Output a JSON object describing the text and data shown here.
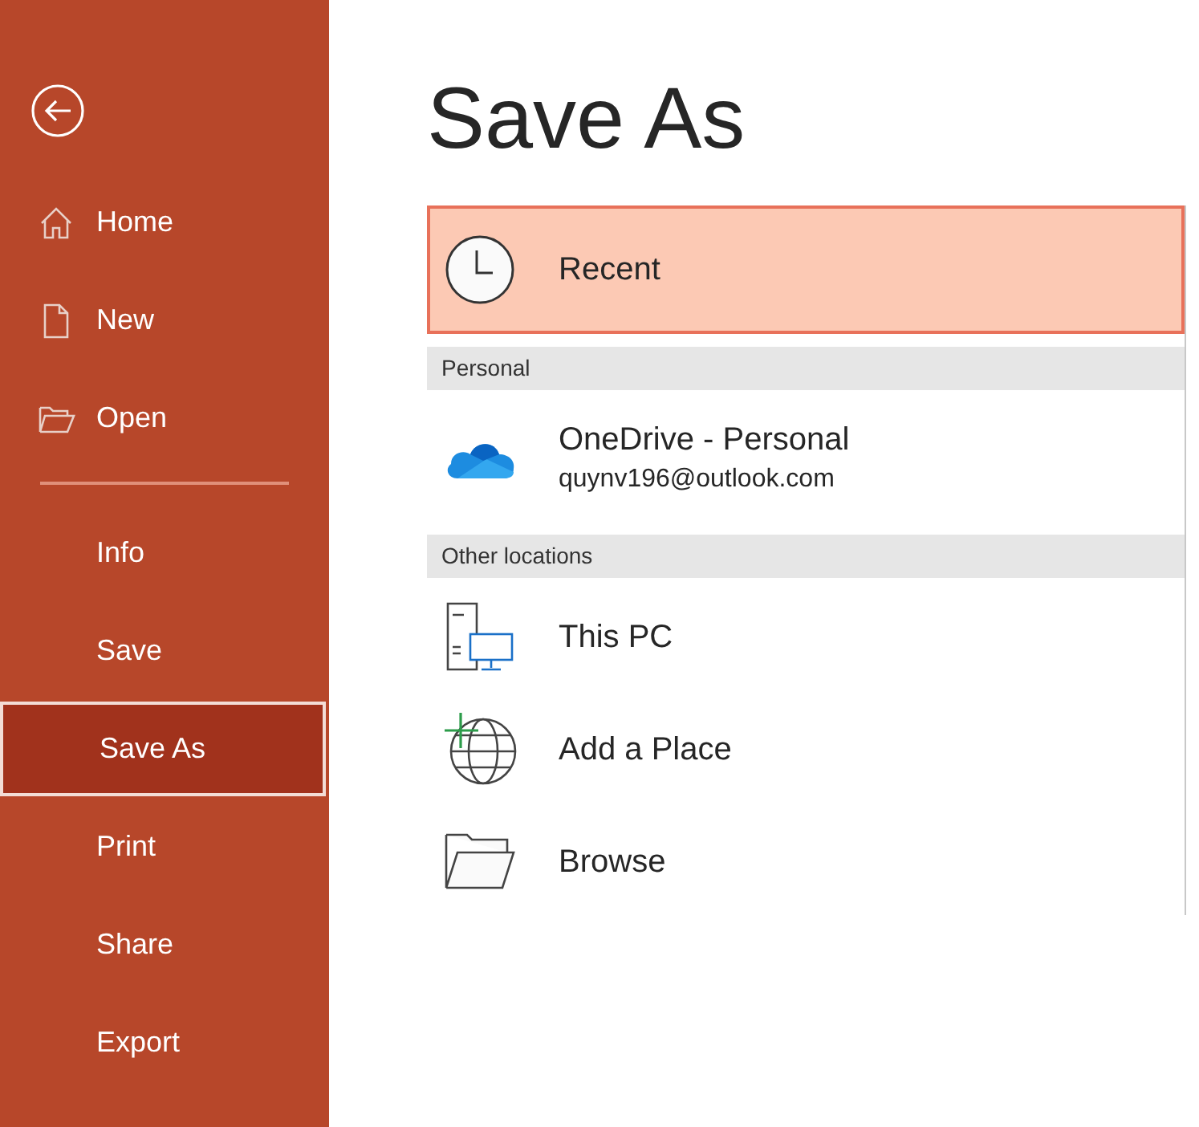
{
  "sidebar": {
    "items": [
      {
        "label": "Home",
        "selected": false
      },
      {
        "label": "New",
        "selected": false
      },
      {
        "label": "Open",
        "selected": false
      },
      {
        "label": "Info",
        "selected": false
      },
      {
        "label": "Save",
        "selected": false
      },
      {
        "label": "Save As",
        "selected": true
      },
      {
        "label": "Print",
        "selected": false
      },
      {
        "label": "Share",
        "selected": false
      },
      {
        "label": "Export",
        "selected": false
      }
    ]
  },
  "title": "Save As",
  "locations": [
    {
      "kind": "item",
      "label": "Recent",
      "selected": true
    },
    {
      "kind": "header",
      "label": "Personal"
    },
    {
      "kind": "item",
      "label": "OneDrive - Personal",
      "sublabel": "quynv196@outlook.com",
      "selected": false
    },
    {
      "kind": "header",
      "label": "Other locations"
    },
    {
      "kind": "item",
      "label": "This PC",
      "selected": false
    },
    {
      "kind": "item",
      "label": "Add a Place",
      "selected": false
    },
    {
      "kind": "item",
      "label": "Browse",
      "selected": false
    }
  ]
}
